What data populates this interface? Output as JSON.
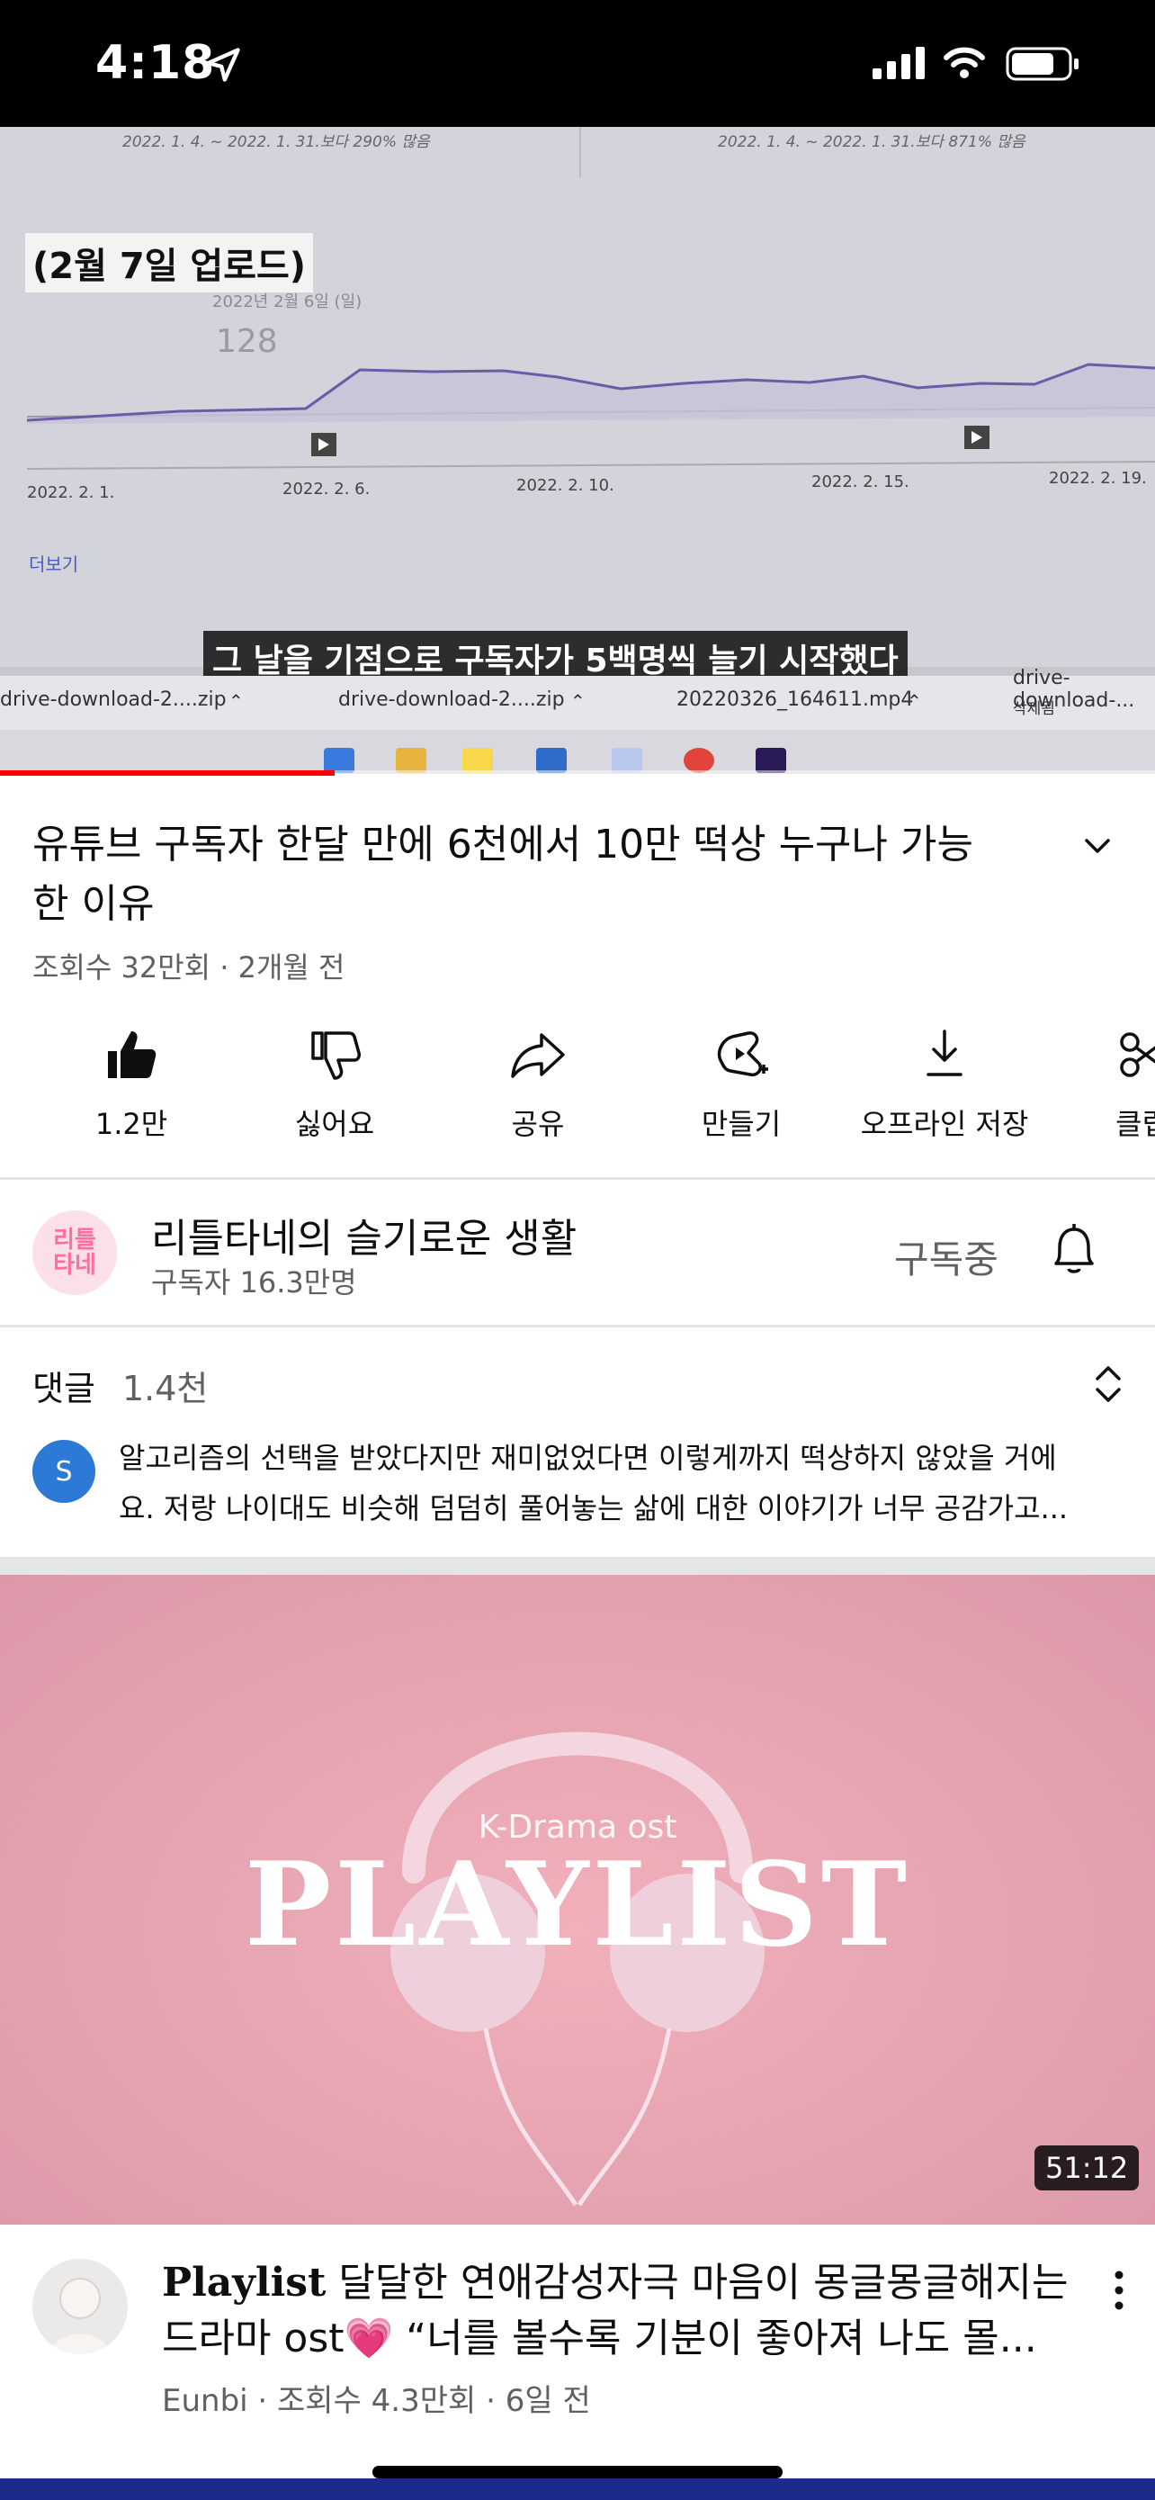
{
  "status_bar": {
    "time": "4:18"
  },
  "player": {
    "upload_tag": "(2월 7일 업로드)",
    "top_notes": [
      "2022. 1. 4. ~ 2022. 1. 31.보다 290% 많음",
      "2022. 1. 4. ~ 2022. 1. 31.보다 871% 많음"
    ],
    "tooltip_date": "2022년 2월 6일 (일)",
    "tooltip_value": "128",
    "x_ticks": [
      "2022. 2. 1.",
      "2022. 2. 6.",
      "2022. 2. 10.",
      "2022. 2. 15.",
      "2022. 2. 19."
    ],
    "more_label": "더보기",
    "caption": "그 날을 기점으로 구독자가 5백명씩 늘기 시작했다",
    "downloads": [
      "drive-download-2....zip",
      "drive-download-2....zip",
      "20220326_164611.mp4",
      "drive-download-..."
    ],
    "download_sub": "삭제됨",
    "progress": 0.29
  },
  "video": {
    "title": "유튜브 구독자 한달 만에 6천에서 10만 떡상 누구나 가능한 이유",
    "meta": "조회수 32만회 · 2개월 전"
  },
  "actions": [
    {
      "icon": "like-icon",
      "label": "1.2만"
    },
    {
      "icon": "dislike-icon",
      "label": "싫어요"
    },
    {
      "icon": "share-icon",
      "label": "공유"
    },
    {
      "icon": "remix-icon",
      "label": "만들기"
    },
    {
      "icon": "download-icon",
      "label": "오프라인 저장"
    },
    {
      "icon": "clip-icon",
      "label": "클립"
    }
  ],
  "channel": {
    "avatar_text": [
      "리틀",
      "타네"
    ],
    "name": "리틀타네의 슬기로운 생활",
    "subs": "구독자 16.3만명",
    "subscribe_label": "구독중"
  },
  "comments": {
    "title": "댓글",
    "count": "1.4천",
    "first_avatar": "S",
    "first_line1": "알고리즘의 선택을 받았다지만 재미없었다면 이렇게까지 떡상하지 않았을 거에",
    "first_line2": "요. 저랑 나이대도 비슷해 덤덤히 풀어놓는 삶에 대한 이야기가 너무 공감가고..."
  },
  "recommended": {
    "thumb_small": "K-Drama ost",
    "thumb_big": "PLAYLIST",
    "duration": "51:12",
    "title_bold": "Playlist",
    "title_rest1": " 달달한 연애감성자극 마음이 몽글몽글해지는",
    "title_line2": "드라마 ost💗 “너를 볼수록 기분이 좋아져 나도 몰...",
    "meta": "Eunbi · 조회수 4.3만회 · 6일 전"
  },
  "colors": {
    "accent_red": "#ff0000",
    "text_primary": "#0f0f0f",
    "text_secondary": "#606060"
  }
}
